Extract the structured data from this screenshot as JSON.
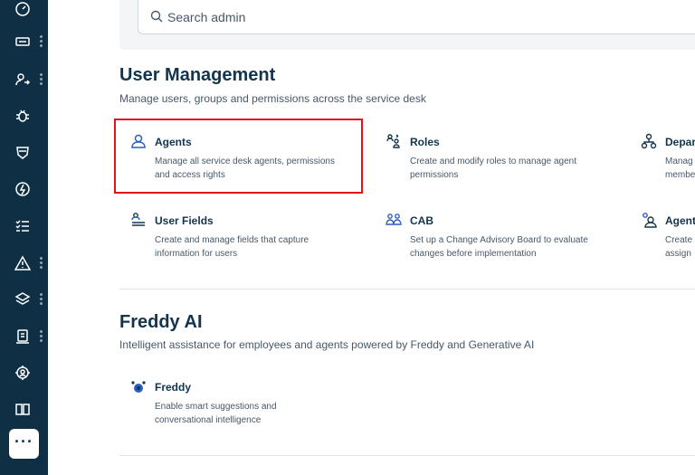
{
  "search": {
    "placeholder": "Search admin"
  },
  "sidebar": {
    "items": [
      {
        "icon": "gauge-icon",
        "has_more": false
      },
      {
        "icon": "ticket-icon",
        "has_more": true
      },
      {
        "icon": "users-swap-icon",
        "has_more": true
      },
      {
        "icon": "bug-icon",
        "has_more": false
      },
      {
        "icon": "shield-stack-icon",
        "has_more": false
      },
      {
        "icon": "lightning-icon",
        "has_more": false
      },
      {
        "icon": "checklist-icon",
        "has_more": false
      },
      {
        "icon": "warning-icon",
        "has_more": true
      },
      {
        "icon": "layers-icon",
        "has_more": true
      },
      {
        "icon": "document-icon",
        "has_more": true
      },
      {
        "icon": "network-icon",
        "has_more": false
      },
      {
        "icon": "book-icon",
        "has_more": false
      }
    ],
    "more_label": "···"
  },
  "user_management": {
    "title": "User Management",
    "subtitle": "Manage users, groups and permissions across the service desk",
    "cards": [
      {
        "title": "Agents",
        "desc": "Manage all service desk agents, permissions and access rights",
        "icon": "agent-icon"
      },
      {
        "title": "Roles",
        "desc": "Create and modify roles to manage agent permissions",
        "icon": "roles-icon"
      },
      {
        "title": "Depar",
        "desc": "Manag membe",
        "icon": "department-icon"
      },
      {
        "title": "User Fields",
        "desc": "Create and manage fields that capture information for users",
        "icon": "user-fields-icon"
      },
      {
        "title": "CAB",
        "desc": "Set up a Change Advisory Board to evaluate changes before implementation",
        "icon": "cab-icon"
      },
      {
        "title": "Agent",
        "desc": "Create assign",
        "icon": "agent-groups-icon"
      }
    ]
  },
  "freddy_ai": {
    "title": "Freddy AI",
    "subtitle": "Intelligent assistance for employees and agents powered by Freddy and Generative AI",
    "cards": [
      {
        "title": "Freddy",
        "desc": "Enable smart suggestions and conversational intelligence",
        "icon": "freddy-icon"
      }
    ]
  },
  "colors": {
    "sidebar": "#0f3044",
    "accent": "#2c5cc5",
    "highlight": "#e0131a"
  }
}
